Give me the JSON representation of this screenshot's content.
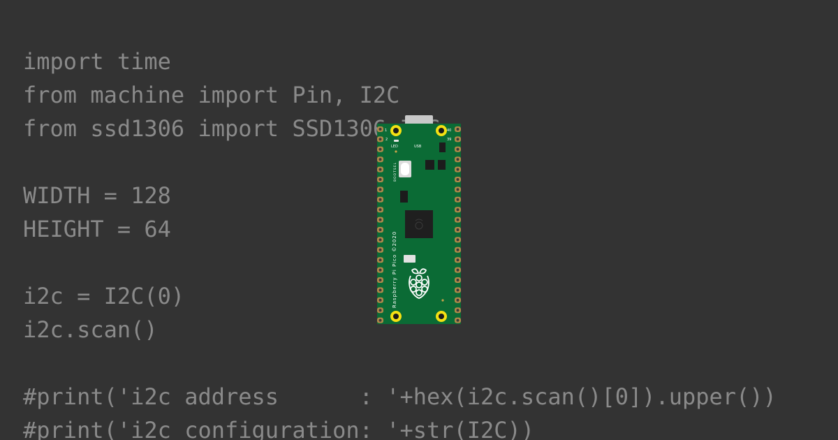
{
  "code_lines": [
    "import time",
    "from machine import Pin, I2C",
    "from ssd1306 import SSD1306_I2C",
    "",
    "WIDTH = 128",
    "HEIGHT = 64",
    "",
    "i2c = I2C(0)",
    "i2c.scan()",
    "",
    "#print('i2c address      : '+hex(i2c.scan()[0]).upper())",
    "#print('i2c configuration: '+str(I2C))"
  ],
  "board": {
    "silkscreen_model": "Raspberry Pi Pico ©2020",
    "usb_label": "USB",
    "led_label": "LED",
    "bootsel_label": "BOOTSEL",
    "pin_1": "1",
    "pin_2": "2",
    "pin_39": "39",
    "pin_40": "40"
  },
  "colors": {
    "background": "#333333",
    "code_text": "#8a8a8a",
    "pcb_green": "#0b6b35",
    "mount_hole_ring": "#f4e013",
    "pad_copper": "#b08a4a"
  }
}
